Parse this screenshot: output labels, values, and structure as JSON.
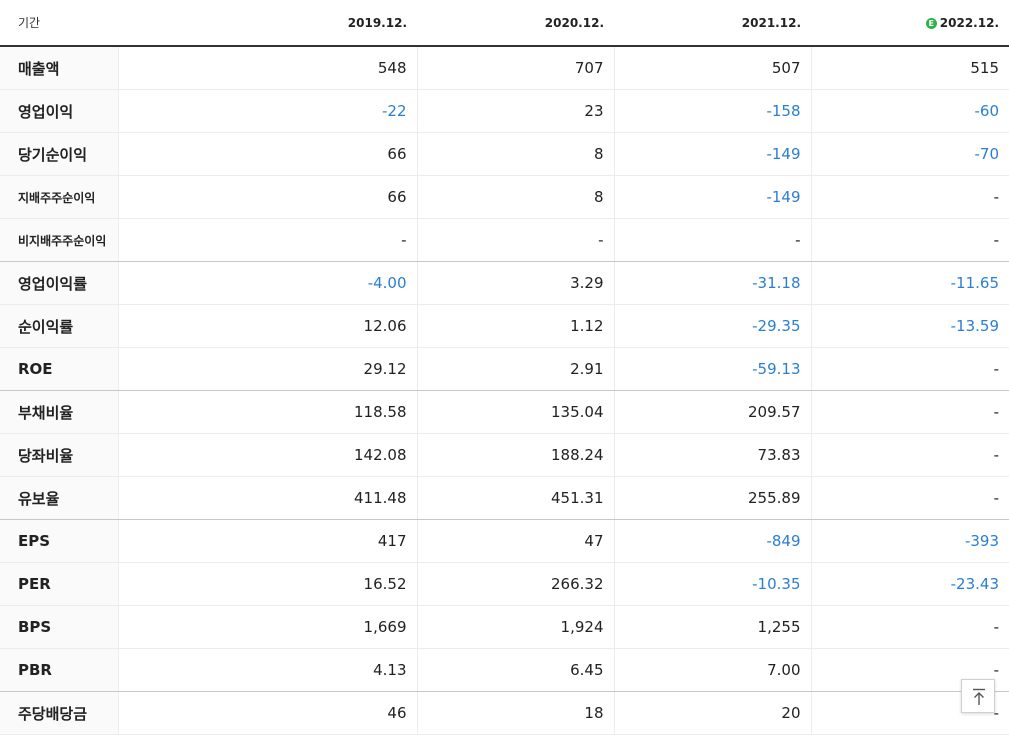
{
  "header": {
    "period_label": "기간",
    "years": [
      "2019.12.",
      "2020.12.",
      "2021.12.",
      "2022.12."
    ],
    "estimate_mark": "E"
  },
  "rows": [
    {
      "label": "매출액",
      "values": [
        "548",
        "707",
        "507",
        "515"
      ]
    },
    {
      "label": "영업이익",
      "values": [
        "-22",
        "23",
        "-158",
        "-60"
      ]
    },
    {
      "label": "당기순이익",
      "values": [
        "66",
        "8",
        "-149",
        "-70"
      ]
    },
    {
      "label": "지배주주순이익",
      "values": [
        "66",
        "8",
        "-149",
        "-"
      ]
    },
    {
      "label": "비지배주주순이익",
      "values": [
        "-",
        "-",
        "-",
        "-"
      ]
    },
    {
      "label": "영업이익률",
      "values": [
        "-4.00",
        "3.29",
        "-31.18",
        "-11.65"
      ]
    },
    {
      "label": "순이익률",
      "values": [
        "12.06",
        "1.12",
        "-29.35",
        "-13.59"
      ]
    },
    {
      "label": "ROE",
      "values": [
        "29.12",
        "2.91",
        "-59.13",
        "-"
      ]
    },
    {
      "label": "부채비율",
      "values": [
        "118.58",
        "135.04",
        "209.57",
        "-"
      ]
    },
    {
      "label": "당좌비율",
      "values": [
        "142.08",
        "188.24",
        "73.83",
        "-"
      ]
    },
    {
      "label": "유보율",
      "values": [
        "411.48",
        "451.31",
        "255.89",
        "-"
      ]
    },
    {
      "label": "EPS",
      "values": [
        "417",
        "47",
        "-849",
        "-393"
      ]
    },
    {
      "label": "PER",
      "values": [
        "16.52",
        "266.32",
        "-10.35",
        "-23.43"
      ]
    },
    {
      "label": "BPS",
      "values": [
        "1,669",
        "1,924",
        "1,255",
        "-"
      ]
    },
    {
      "label": "PBR",
      "values": [
        "4.13",
        "6.45",
        "7.00",
        "-"
      ]
    },
    {
      "label": "주당배당금",
      "values": [
        "46",
        "18",
        "20",
        "-"
      ]
    }
  ],
  "colors": {
    "negative": "#2a7ed3",
    "estimate_badge": "#2eb24b"
  },
  "scroll_top_button": {
    "icon": "arrow-up-to-top-icon"
  }
}
